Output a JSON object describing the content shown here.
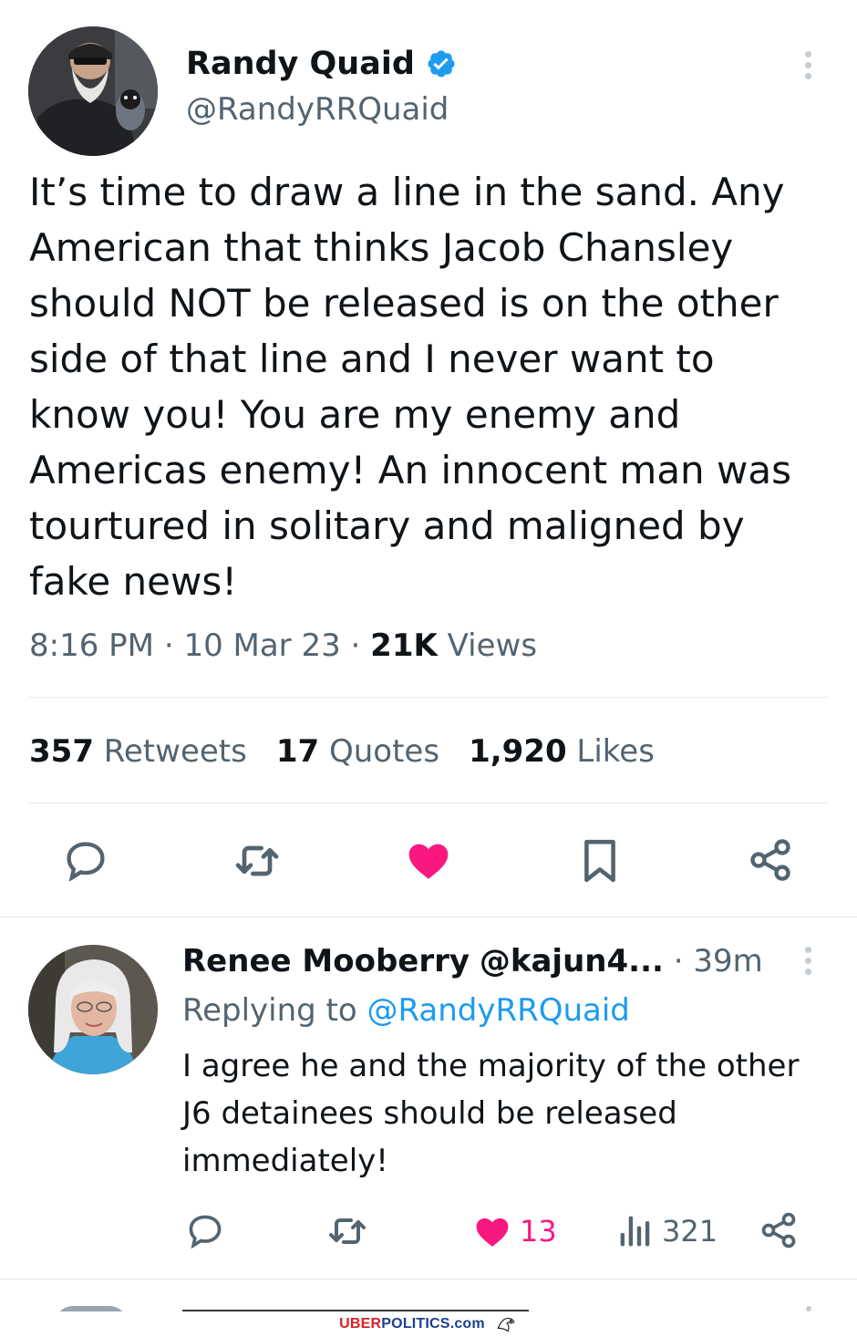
{
  "tweet": {
    "author": {
      "name": "Randy Quaid",
      "handle": "@RandyRRQuaid",
      "verified": true
    },
    "text": "It’s time to draw a line in the sand. Any American that thinks Jacob Chansley should NOT be released is on the other side of that line and I never want to know you! You are my enemy and Americas enemy! An innocent man was tourtured in solitary and maligned by fake news!",
    "time": "8:16 PM",
    "date": "10 Mar 23",
    "views_count": "21K",
    "views_label": "Views",
    "sep": "·",
    "stats": {
      "retweets_count": "357",
      "retweets_label": "Retweets",
      "quotes_count": "17",
      "quotes_label": "Quotes",
      "likes_count": "1,920",
      "likes_label": "Likes"
    },
    "actions": [
      "reply-icon",
      "retweet-icon",
      "like-icon",
      "bookmark-icon",
      "share-icon"
    ]
  },
  "reply": {
    "author": {
      "name": "Renee Mooberry",
      "handle": "@kajun4...",
      "time": "· 39m"
    },
    "replying_to_label": "Replying to",
    "replying_to_handle": "@RandyRRQuaid",
    "text": "I agree he and the majority of the other J6 detainees should be released immediately!",
    "likes": "13",
    "views": "321"
  },
  "colors": {
    "accent_blue": "#1d9bf0",
    "like_pink": "#f91880",
    "muted": "#536471",
    "text": "#0f1419"
  },
  "footer": {
    "logo_uber": "UBER",
    "logo_politics": "POLITICS",
    "logo_tld": ".com"
  }
}
